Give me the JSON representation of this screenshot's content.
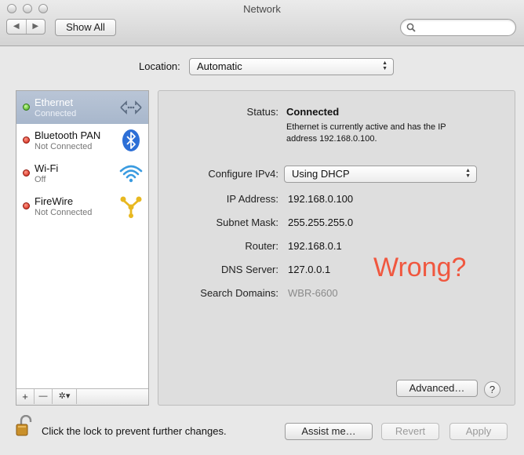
{
  "window": {
    "title": "Network"
  },
  "toolbar": {
    "back": "◀",
    "forward": "▶",
    "show_all": "Show All",
    "search_placeholder": ""
  },
  "location": {
    "label": "Location:",
    "value": "Automatic"
  },
  "services": [
    {
      "name": "Ethernet",
      "status": "Connected",
      "dot": "green",
      "icon": "ethernet-arrows-icon",
      "selected": true
    },
    {
      "name": "Bluetooth PAN",
      "status": "Not Connected",
      "dot": "red",
      "icon": "bluetooth-icon"
    },
    {
      "name": "Wi-Fi",
      "status": "Off",
      "dot": "red",
      "icon": "wifi-icon"
    },
    {
      "name": "FireWire",
      "status": "Not Connected",
      "dot": "red",
      "icon": "firewire-icon"
    }
  ],
  "sidebar_controls": {
    "add": "+",
    "remove": "—",
    "action": "✲▾"
  },
  "details": {
    "status_label": "Status:",
    "status_value": "Connected",
    "status_desc_1": "Ethernet is currently active and has the IP",
    "status_desc_2": "address 192.168.0.100.",
    "configure_label": "Configure IPv4:",
    "configure_value": "Using DHCP",
    "ip_label": "IP Address:",
    "ip_value": "192.168.0.100",
    "subnet_label": "Subnet Mask:",
    "subnet_value": "255.255.255.0",
    "router_label": "Router:",
    "router_value": "192.168.0.1",
    "dns_label": "DNS Server:",
    "dns_value": "127.0.0.1",
    "search_label": "Search Domains:",
    "search_value": "WBR-6600",
    "annotation": "Wrong?",
    "advanced": "Advanced…",
    "help": "?"
  },
  "footer": {
    "lock_text": "Click the lock to prevent further changes.",
    "assist": "Assist me…",
    "revert": "Revert",
    "apply": "Apply"
  },
  "colors": {
    "annotation": "#f0573f",
    "selected_row": "#acbacd"
  }
}
